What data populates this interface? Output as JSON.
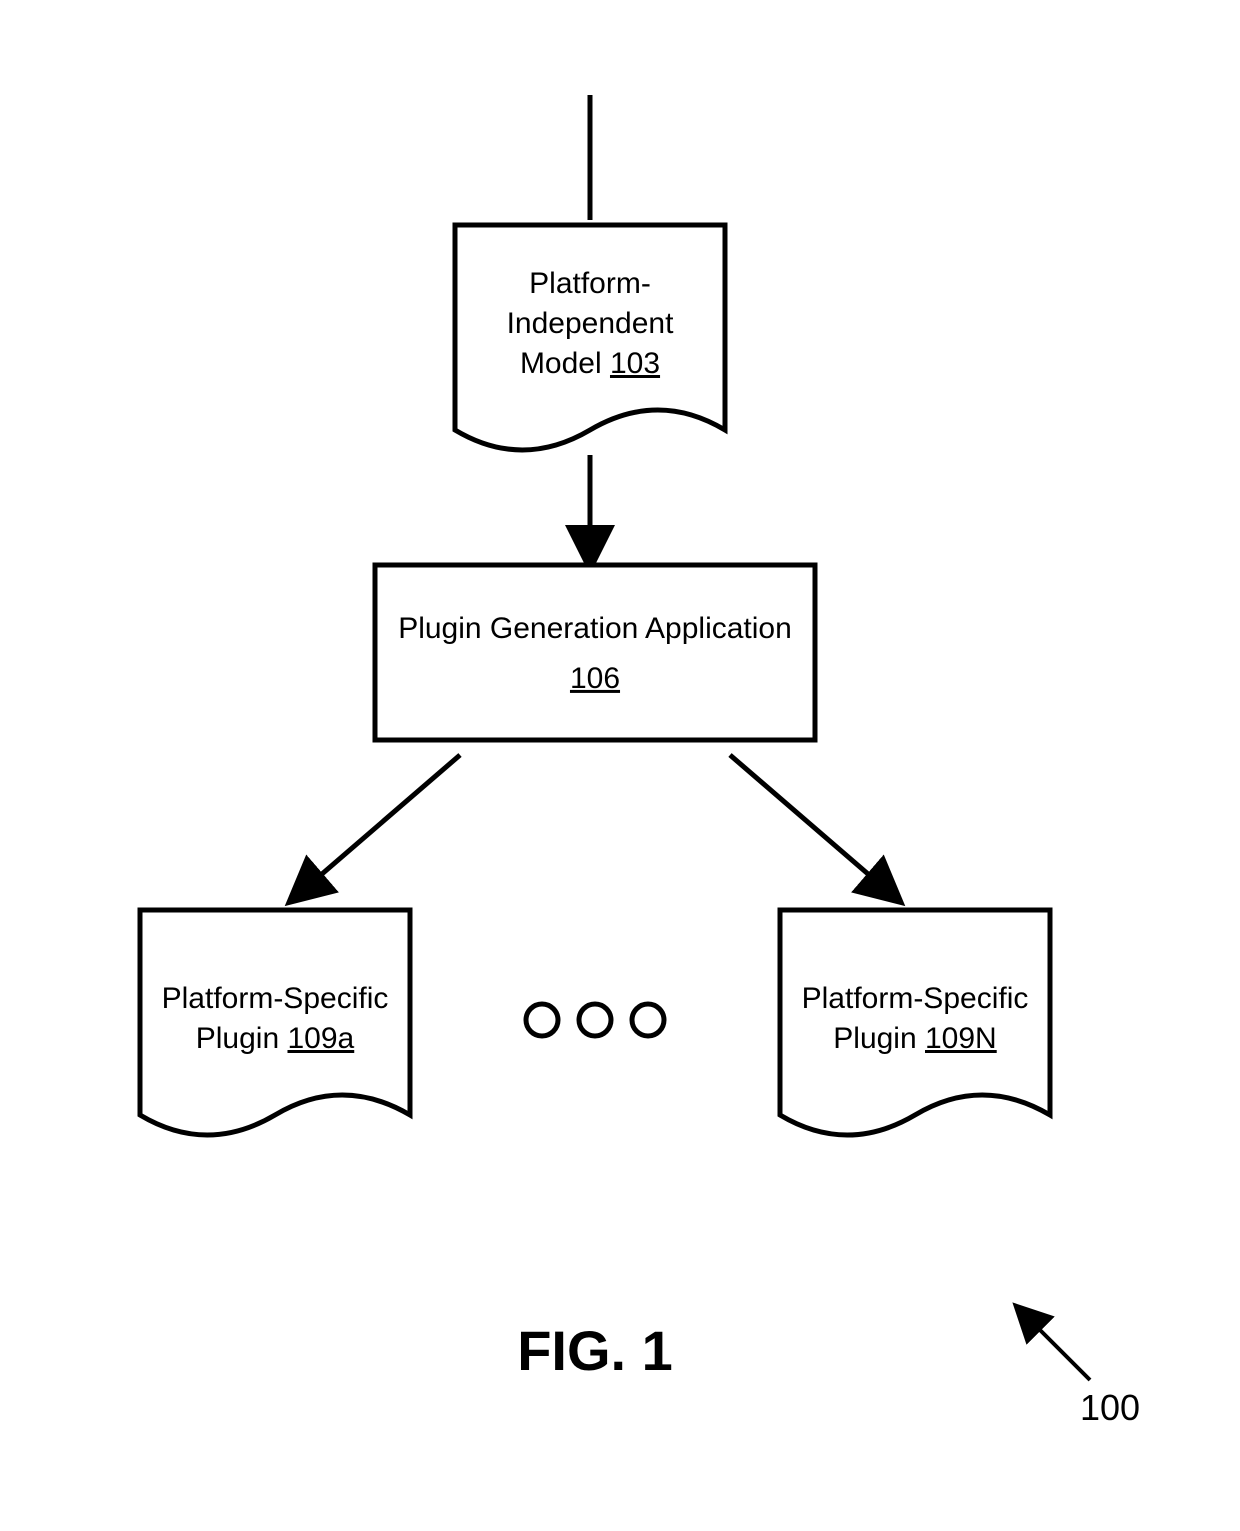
{
  "blocks": {
    "model": {
      "line1": "Platform-",
      "line2": "Independent",
      "line3_prefix": "Model ",
      "line3_num": "103"
    },
    "app": {
      "line1": "Plugin Generation Application",
      "line2_num": "106"
    },
    "pluginA": {
      "line1": "Platform-Specific",
      "line2_prefix": "Plugin ",
      "line2_num": "109a"
    },
    "pluginN": {
      "line1": "Platform-Specific",
      "line2_prefix": "Plugin ",
      "line2_num": "109N"
    }
  },
  "figure_label": "FIG. 1",
  "figure_num": "100"
}
